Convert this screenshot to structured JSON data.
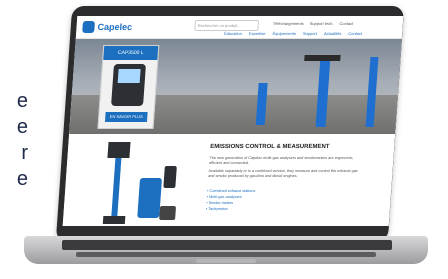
{
  "left_copy": [
    "e",
    "e",
    "r",
    "e"
  ],
  "site": {
    "logo_text": "Capelec",
    "search_placeholder": "Rechercher un produit...",
    "top_links": [
      "Téléchargements",
      "Support tech.",
      "Contact"
    ],
    "nav": [
      "Éducation",
      "Expertise",
      "Équipements",
      "Support",
      "Actualités",
      "Contact"
    ],
    "promo": {
      "badge": "CAP3500 L",
      "button": "EN SAVOIR PLUS"
    },
    "section": {
      "title": "EMISSIONS CONTROL & MEASUREMENT",
      "intro": "The new generation of Capelec multi-gas analysers and smokemeters are ergonomic, efficient and connected.",
      "body": "Available separately or in a combined version, they measure and control the exhaust gas and smoke produced by gasoline and diesel engines.",
      "items": [
        "Combined exhaust stations",
        "Multi-gas analysers",
        "Smoke meters",
        "Tachymeter"
      ]
    }
  }
}
